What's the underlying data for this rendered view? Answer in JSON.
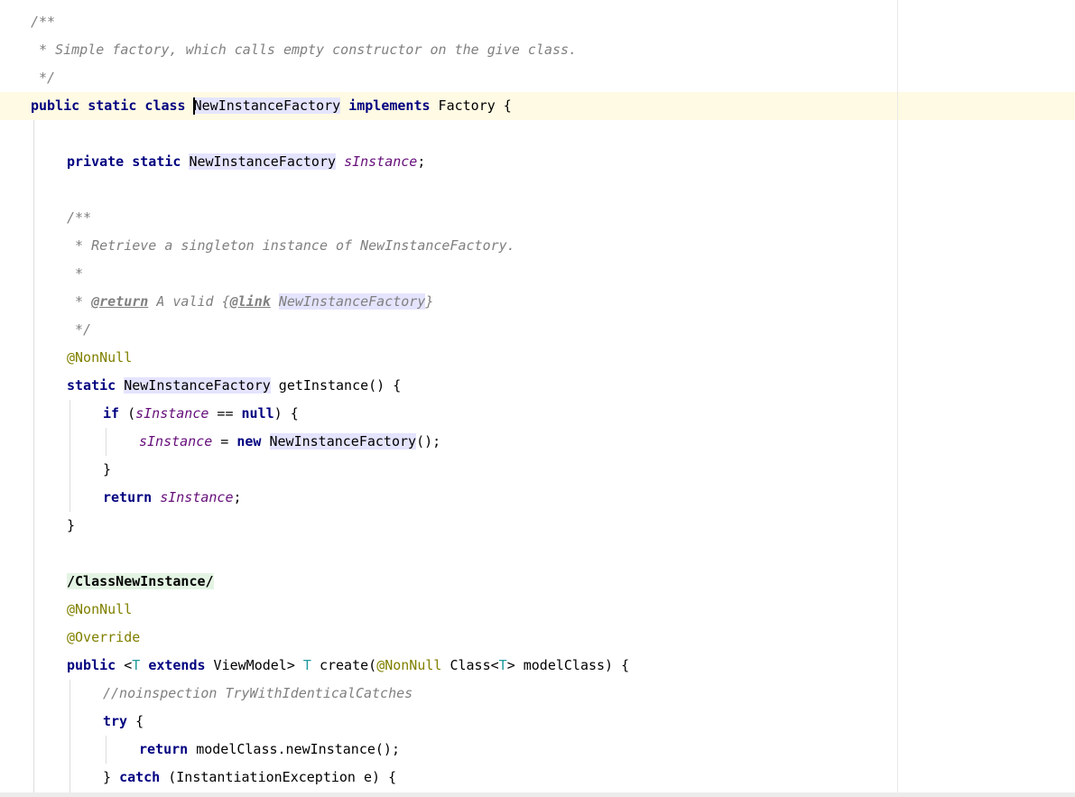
{
  "editor": {
    "lines": [
      [
        {
          "t": "/**",
          "c": "cm"
        }
      ],
      [
        {
          "t": " * Simple factory, which calls empty constructor on the give class.",
          "c": "cm"
        }
      ],
      [
        {
          "t": " */",
          "c": "cm"
        }
      ],
      [
        {
          "t": "public static class ",
          "c": "kw"
        },
        {
          "t": "NewInstanceFactory",
          "c": "pl hl"
        },
        {
          "t": " "
        },
        {
          "t": "implements",
          "c": "kw"
        },
        {
          "t": " Factory {"
        }
      ],
      [
        {
          "t": ""
        }
      ],
      [
        {
          "t": "private static ",
          "c": "kw"
        },
        {
          "t": "NewInstanceFactory",
          "c": "pl hl"
        },
        {
          "t": " "
        },
        {
          "t": "sInstance",
          "c": "fld"
        },
        {
          "t": ";"
        }
      ],
      [
        {
          "t": ""
        }
      ],
      [
        {
          "t": "/**",
          "c": "cm"
        }
      ],
      [
        {
          "t": " * Retrieve a singleton instance of NewInstanceFactory.",
          "c": "cm"
        }
      ],
      [
        {
          "t": " *",
          "c": "cm"
        }
      ],
      [
        {
          "t": " * ",
          "c": "cm"
        },
        {
          "t": "@return",
          "c": "tag"
        },
        {
          "t": " A valid {",
          "c": "cm"
        },
        {
          "t": "@link",
          "c": "tag"
        },
        {
          "t": " ",
          "c": "cm"
        },
        {
          "t": "NewInstanceFactory",
          "c": "cm hl"
        },
        {
          "t": "}",
          "c": "cm"
        }
      ],
      [
        {
          "t": " */",
          "c": "cm"
        }
      ],
      [
        {
          "t": "@NonNull",
          "c": "an"
        }
      ],
      [
        {
          "t": "static ",
          "c": "kw"
        },
        {
          "t": "NewInstanceFactory",
          "c": "pl hl"
        },
        {
          "t": " getInstance() {"
        }
      ],
      [
        {
          "t": "if",
          "c": "kw"
        },
        {
          "t": " ("
        },
        {
          "t": "sInstance",
          "c": "fld"
        },
        {
          "t": " == "
        },
        {
          "t": "null",
          "c": "kw"
        },
        {
          "t": ") {"
        }
      ],
      [
        {
          "t": "sInstance",
          "c": "fld"
        },
        {
          "t": " = "
        },
        {
          "t": "new",
          "c": "kw"
        },
        {
          "t": " "
        },
        {
          "t": "NewInstanceFactory",
          "c": "pl hl"
        },
        {
          "t": "();"
        }
      ],
      [
        {
          "t": "}"
        }
      ],
      [
        {
          "t": "return ",
          "c": "kw"
        },
        {
          "t": "sInstance",
          "c": "fld"
        },
        {
          "t": ";"
        }
      ],
      [
        {
          "t": "}"
        }
      ],
      [
        {
          "t": ""
        }
      ],
      [
        {
          "t": "/ClassNewInstance/",
          "c": "rg"
        }
      ],
      [
        {
          "t": "@NonNull",
          "c": "an"
        }
      ],
      [
        {
          "t": "@Override",
          "c": "an"
        }
      ],
      [
        {
          "t": "public ",
          "c": "kw"
        },
        {
          "t": "<"
        },
        {
          "t": "T",
          "c": "tp"
        },
        {
          "t": " "
        },
        {
          "t": "extends",
          "c": "kw"
        },
        {
          "t": " ViewModel> "
        },
        {
          "t": "T",
          "c": "tp"
        },
        {
          "t": " create("
        },
        {
          "t": "@NonNull",
          "c": "an"
        },
        {
          "t": " Class<"
        },
        {
          "t": "T",
          "c": "tp"
        },
        {
          "t": "> modelClass) {"
        }
      ],
      [
        {
          "t": "//noinspection TryWithIdenticalCatches",
          "c": "cm"
        }
      ],
      [
        {
          "t": "try",
          "c": "kw"
        },
        {
          "t": " {"
        }
      ],
      [
        {
          "t": "return ",
          "c": "kw"
        },
        {
          "t": "modelClass.newInstance();"
        }
      ],
      [
        {
          "t": "} "
        },
        {
          "t": "catch",
          "c": "kw"
        },
        {
          "t": " (InstantiationException e) {"
        }
      ]
    ]
  }
}
